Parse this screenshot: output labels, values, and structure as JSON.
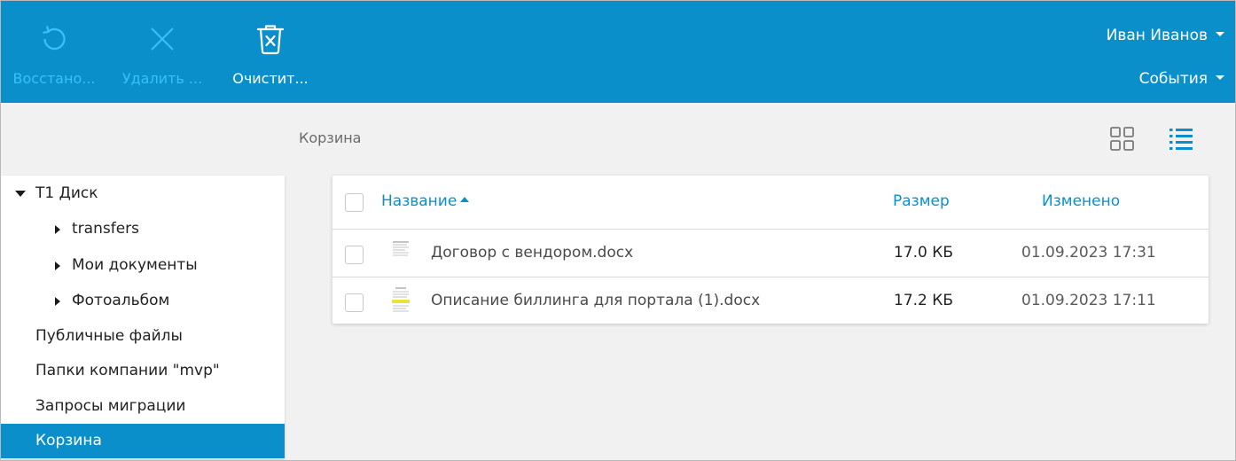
{
  "toolbar": {
    "restore_label": "Восстано...",
    "delete_label": "Удалить ...",
    "empty_label": "Очистит...",
    "restore_icon": "restore-icon",
    "delete_icon": "close-icon",
    "empty_icon": "trash-x-icon"
  },
  "user": {
    "name": "Иван Иванов",
    "events": "События"
  },
  "breadcrumb": "Корзина",
  "sidebar": {
    "root": "Т1 Диск",
    "children": [
      "transfers",
      "Мои документы",
      "Фотоальбом"
    ],
    "items": [
      "Публичные файлы",
      "Папки компании \"mvp\"",
      "Запросы миграции",
      "Корзина"
    ]
  },
  "table": {
    "headers": {
      "name": "Название",
      "size": "Размер",
      "modified": "Изменено"
    },
    "rows": [
      {
        "name": "Договор с вендором.docx",
        "size": "17.0 КБ",
        "modified": "01.09.2023 17:31"
      },
      {
        "name": "Описание биллинга для портала (1).docx",
        "size": "17.2 КБ",
        "modified": "01.09.2023 17:11"
      }
    ]
  },
  "colors": {
    "accent": "#0a8fca",
    "disabled_text": "#38c0f7",
    "background": "#f1f1f1"
  }
}
